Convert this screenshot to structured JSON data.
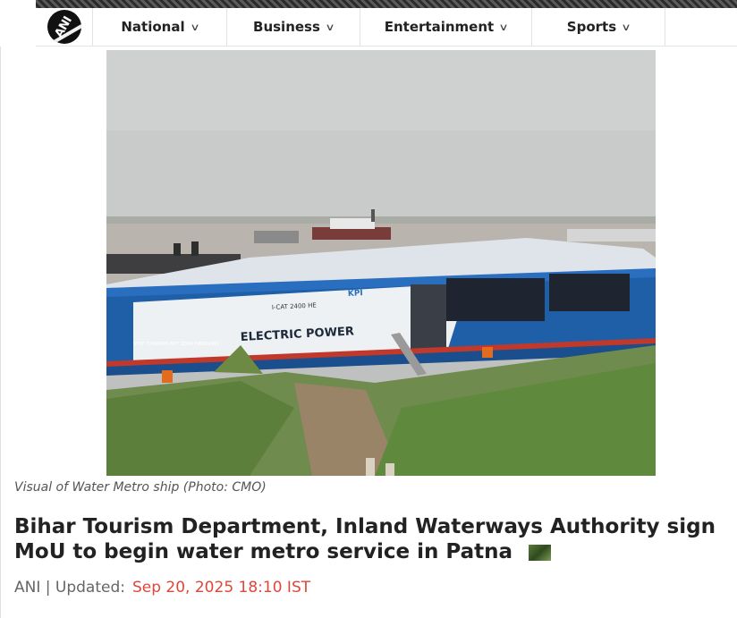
{
  "header": {
    "logo_text": "ANI",
    "nav_items": [
      {
        "label": "National"
      },
      {
        "label": "Business"
      },
      {
        "label": "Entertainment"
      },
      {
        "label": "Sports"
      }
    ]
  },
  "article": {
    "photo": {
      "ship_hull_text": "ELECTRIC POWER",
      "ship_code": "I-CAT 2400 HE",
      "ship_brand": "KPI",
      "ship_slogan": "STEP TOWARDS NET ZERO EMISSIONS",
      "ship_subtext": "NET ZERO EMISSIONS"
    },
    "caption": "Visual of Water Metro ship (Photo: CMO)",
    "headline": "Bihar Tourism Department, Inland Waterways Authority sign MoU to begin water metro service in Patna",
    "byline": {
      "source": "ANI | Updated:",
      "date": "Sep 20, 2025 18:10 IST"
    }
  },
  "colors": {
    "hull_blue": "#1f5fa8",
    "date_red": "#e0463a",
    "text_dark": "#222222"
  }
}
